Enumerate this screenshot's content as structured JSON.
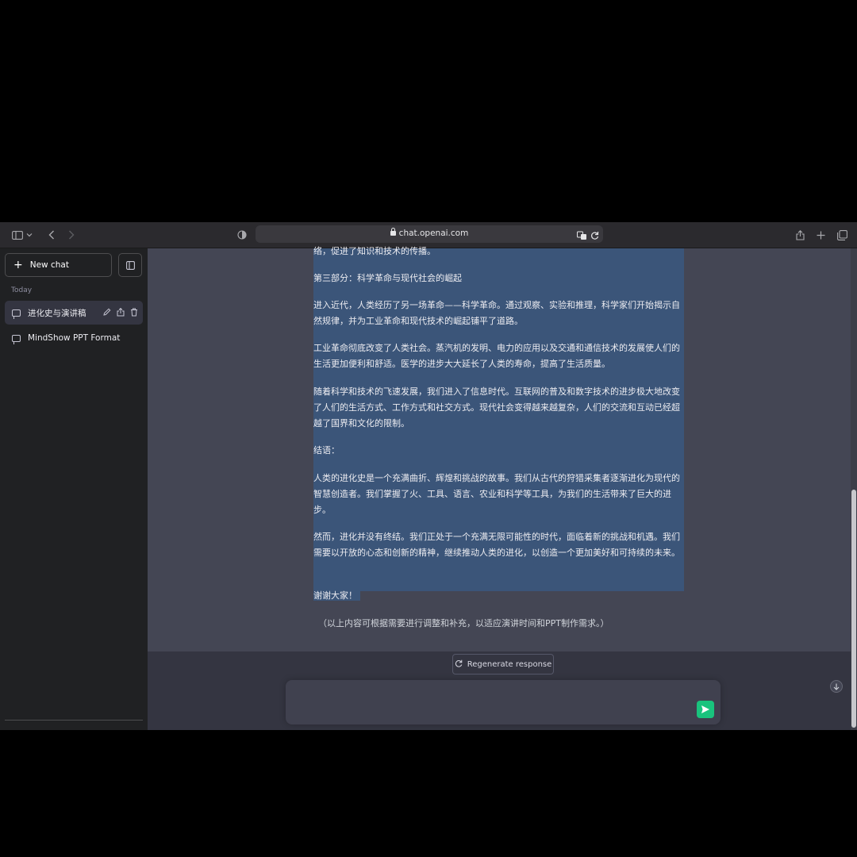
{
  "browser": {
    "url": "chat.openai.com"
  },
  "sidebar": {
    "new_chat_label": "New chat",
    "section_today": "Today",
    "conversations": [
      {
        "title": "进化史与演讲稿"
      },
      {
        "title": "MindShow PPT Format"
      }
    ]
  },
  "message": {
    "paragraphs": [
      "络，促进了知识和技术的传播。",
      "第三部分：科学革命与现代社会的崛起",
      "进入近代，人类经历了另一场革命——科学革命。通过观察、实验和推理，科学家们开始揭示自然规律，并为工业革命和现代技术的崛起铺平了道路。",
      "工业革命彻底改变了人类社会。蒸汽机的发明、电力的应用以及交通和通信技术的发展使人们的生活更加便利和舒适。医学的进步大大延长了人类的寿命，提高了生活质量。",
      "随着科学和技术的飞速发展，我们进入了信息时代。互联网的普及和数字技术的进步极大地改变了人们的生活方式、工作方式和社交方式。现代社会变得越来越复杂，人们的交流和互动已经超越了国界和文化的限制。",
      "结语：",
      "人类的进化史是一个充满曲折、辉煌和挑战的故事。我们从古代的狩猎采集者逐渐进化为现代的智慧创造者。我们掌握了火、工具、语言、农业和科学等工具，为我们的生活带来了巨大的进步。",
      "然而，进化并没有终结。我们正处于一个充满无限可能性的时代，面临着新的挑战和机遇。我们需要以开放的心态和创新的精神，继续推动人类的进化，以创造一个更加美好和可持续的未来。",
      "谢谢大家！"
    ],
    "note": "（以上内容可根据需要进行调整和补充，以适应演讲时间和PPT制作需求。）"
  },
  "composer": {
    "regenerate_label": "Regenerate response",
    "placeholder": ""
  },
  "colors": {
    "selection": "#3b5579",
    "send_button": "#19c37d",
    "sidebar_bg": "#202123",
    "main_bg": "#444654"
  }
}
